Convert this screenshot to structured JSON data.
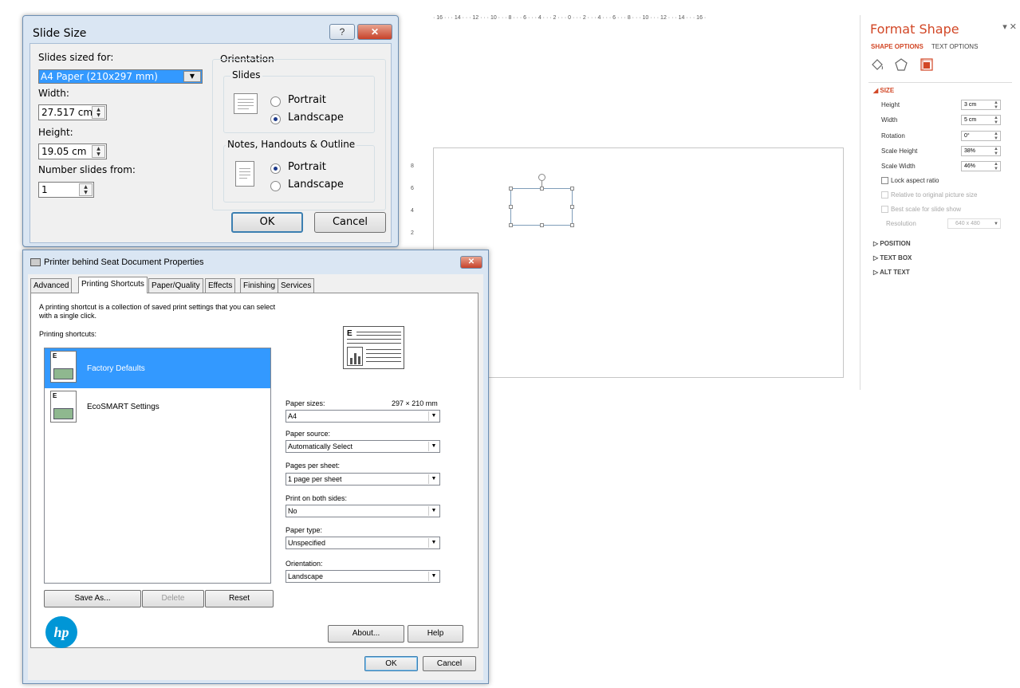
{
  "slide_editor": {
    "ruler_top": "· 16 · · · 14 · · · 12 · · · 10 · · · 8 · · · 6 · · · 4 · · · 2 · · · 0 · · · 2 · · · 4 · · · 6 · · · 8 · · · 10 · · · 12 · · · 14 · · · 16 ·",
    "ruler_left": [
      "8",
      "6",
      "4",
      "2"
    ]
  },
  "format_pane": {
    "title": "Format Shape",
    "controls": "▾ ✕",
    "tabs": {
      "shape_options": "SHAPE OPTIONS",
      "text_options": "TEXT OPTIONS"
    },
    "icons": [
      "fill-line-icon",
      "effects-icon",
      "size-properties-icon"
    ],
    "size_section": {
      "header": "◢ SIZE",
      "height": {
        "label": "Height",
        "value": "3 cm"
      },
      "width": {
        "label": "Width",
        "value": "5 cm"
      },
      "rotation": {
        "label": "Rotation",
        "value": "0°"
      },
      "scale_height": {
        "label": "Scale Height",
        "value": "38%"
      },
      "scale_width": {
        "label": "Scale Width",
        "value": "46%"
      },
      "lock_aspect": "Lock aspect ratio",
      "relative_original": "Relative to original picture size",
      "best_scale": "Best scale for slide show",
      "resolution": {
        "label": "Resolution",
        "value": "640 x 480"
      }
    },
    "sections": [
      "▷ POSITION",
      "▷ TEXT BOX",
      "▷ ALT TEXT"
    ]
  },
  "slide_size_dialog": {
    "title": "Slide Size",
    "help_button": "?",
    "close_button": "✕",
    "slides_sized_for": {
      "label": "Slides sized for:",
      "value": "A4 Paper (210x297 mm)"
    },
    "width": {
      "label": "Width:",
      "value": "27.517 cm"
    },
    "height": {
      "label": "Height:",
      "value": "19.05 cm"
    },
    "number_from": {
      "label": "Number slides from:",
      "value": "1"
    },
    "orientation": {
      "label": "Orientation",
      "slides": {
        "label": "Slides",
        "portrait": "Portrait",
        "landscape": "Landscape",
        "selected": "landscape"
      },
      "notes": {
        "label": "Notes, Handouts & Outline",
        "portrait": "Portrait",
        "landscape": "Landscape",
        "selected": "portrait"
      }
    },
    "ok": "OK",
    "cancel": "Cancel"
  },
  "printer_dialog": {
    "title": "Printer behind Seat Document Properties",
    "close_button": "✕",
    "tabs": [
      "Advanced",
      "Printing Shortcuts",
      "Paper/Quality",
      "Effects",
      "Finishing",
      "Services"
    ],
    "active_tab": "Printing Shortcuts",
    "description_line1": "A printing shortcut is a collection of saved print settings that you can select",
    "description_line2": "with a single click.",
    "shortcuts_label": "Printing shortcuts:",
    "shortcuts": [
      {
        "name": "Factory Defaults",
        "selected": true
      },
      {
        "name": "EcoSMART Settings",
        "selected": false
      }
    ],
    "paper_sizes": {
      "label": "Paper sizes:",
      "dimensions": "297 × 210 mm",
      "value": "A4"
    },
    "paper_source": {
      "label": "Paper source:",
      "value": "Automatically Select"
    },
    "pages_per_sheet": {
      "label": "Pages per sheet:",
      "value": "1 page per sheet"
    },
    "print_both_sides": {
      "label": "Print on both sides:",
      "value": "No"
    },
    "paper_type": {
      "label": "Paper type:",
      "value": "Unspecified"
    },
    "orientation": {
      "label": "Orientation:",
      "value": "Landscape"
    },
    "save_as": "Save As...",
    "delete": "Delete",
    "reset": "Reset",
    "logo": "hp",
    "about": "About...",
    "help": "Help",
    "ok": "OK",
    "cancel": "Cancel"
  }
}
